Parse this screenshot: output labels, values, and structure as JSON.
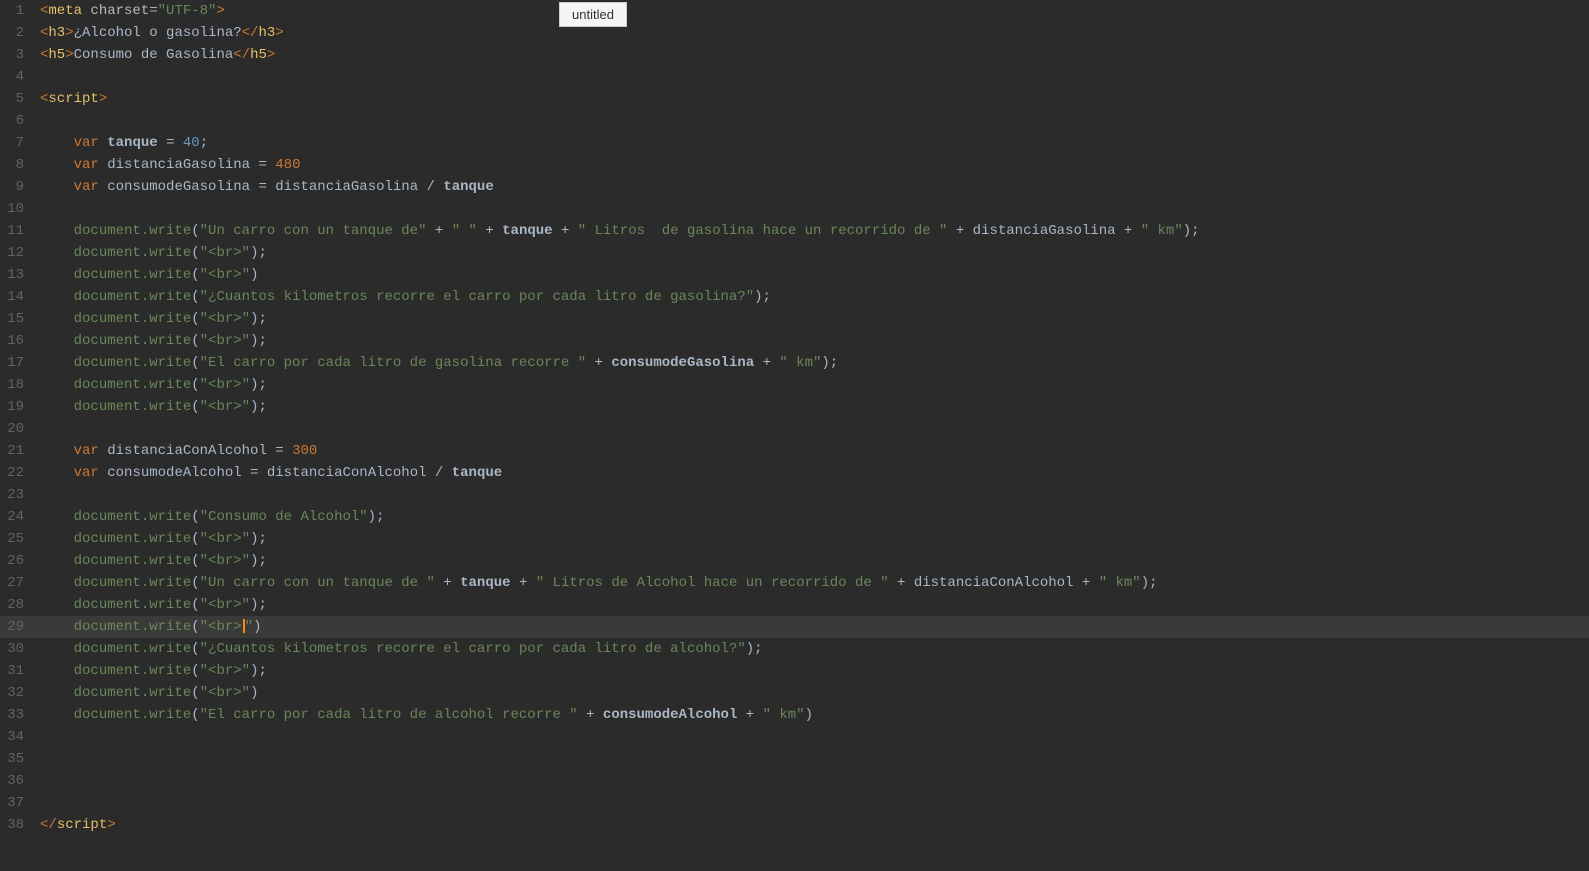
{
  "tooltip": {
    "text": "untitled"
  },
  "editor": {
    "lines": [
      {
        "num": 1,
        "highlighted": false
      },
      {
        "num": 2,
        "highlighted": false
      },
      {
        "num": 3,
        "highlighted": false
      },
      {
        "num": 4,
        "highlighted": false
      },
      {
        "num": 5,
        "highlighted": false
      },
      {
        "num": 6,
        "highlighted": false
      },
      {
        "num": 7,
        "highlighted": false
      },
      {
        "num": 8,
        "highlighted": false
      },
      {
        "num": 9,
        "highlighted": false
      },
      {
        "num": 10,
        "highlighted": false
      },
      {
        "num": 11,
        "highlighted": false
      },
      {
        "num": 12,
        "highlighted": false
      },
      {
        "num": 13,
        "highlighted": false
      },
      {
        "num": 14,
        "highlighted": false
      },
      {
        "num": 15,
        "highlighted": false
      },
      {
        "num": 16,
        "highlighted": false
      },
      {
        "num": 17,
        "highlighted": false
      },
      {
        "num": 18,
        "highlighted": false
      },
      {
        "num": 19,
        "highlighted": false
      },
      {
        "num": 20,
        "highlighted": false
      },
      {
        "num": 21,
        "highlighted": false
      },
      {
        "num": 22,
        "highlighted": false
      },
      {
        "num": 23,
        "highlighted": false
      },
      {
        "num": 24,
        "highlighted": false
      },
      {
        "num": 25,
        "highlighted": false
      },
      {
        "num": 26,
        "highlighted": false
      },
      {
        "num": 27,
        "highlighted": false
      },
      {
        "num": 28,
        "highlighted": false
      },
      {
        "num": 29,
        "highlighted": true
      },
      {
        "num": 30,
        "highlighted": false
      },
      {
        "num": 31,
        "highlighted": false
      },
      {
        "num": 32,
        "highlighted": false
      },
      {
        "num": 33,
        "highlighted": false
      },
      {
        "num": 34,
        "highlighted": false
      },
      {
        "num": 35,
        "highlighted": false
      },
      {
        "num": 36,
        "highlighted": false
      },
      {
        "num": 37,
        "highlighted": false
      },
      {
        "num": 38,
        "highlighted": false
      }
    ]
  }
}
